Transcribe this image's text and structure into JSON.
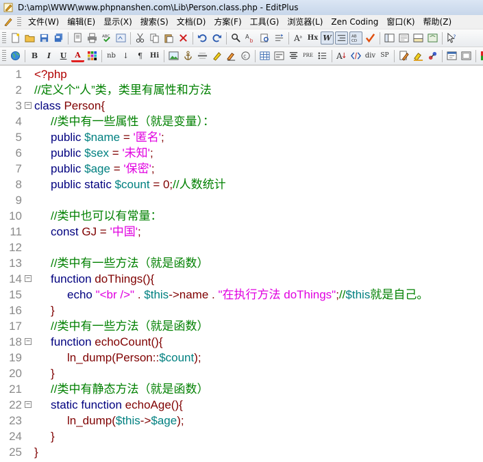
{
  "window": {
    "title": "D:\\amp\\WWW\\www.phpnanshen.com\\Lib\\Person.class.php - EditPlus"
  },
  "menu": [
    "文件(W)",
    "编辑(E)",
    "显示(X)",
    "搜索(S)",
    "文档(D)",
    "方案(F)",
    "工具(G)",
    "浏览器(L)",
    "Zen Coding",
    "窗口(K)",
    "帮助(Z)"
  ],
  "toolbar2_labels": {
    "bold": "B",
    "italic": "I",
    "underline": "U",
    "font_color": "A",
    "nbsp": "nb",
    "link": "↓",
    "paragraph": "¶",
    "heading": "Hi",
    "font_size": "A",
    "hx": "Hx",
    "word_wrap": "W",
    "preview": "PRE",
    "div": "div",
    "span": "SP"
  },
  "editor": {
    "lines": [
      {
        "n": "1",
        "fold": false,
        "indent": 0,
        "tokens": [
          {
            "t": "<?php",
            "c": "p"
          }
        ]
      },
      {
        "n": "2",
        "fold": false,
        "indent": 0,
        "tokens": [
          {
            "t": "//定义个“人”类，类里有属性和方法",
            "c": "c"
          }
        ]
      },
      {
        "n": "3",
        "fold": true,
        "indent": 0,
        "tokens": [
          {
            "t": "class ",
            "c": "k"
          },
          {
            "t": "Person{",
            "c": "d"
          }
        ]
      },
      {
        "n": "4",
        "fold": false,
        "indent": 1,
        "tokens": [
          {
            "t": "//类中有一些属性（就是变量）：",
            "c": "c"
          }
        ]
      },
      {
        "n": "5",
        "fold": false,
        "indent": 1,
        "tokens": [
          {
            "t": "public ",
            "c": "k"
          },
          {
            "t": "$name",
            "c": "v"
          },
          {
            "t": " = ",
            "c": "d"
          },
          {
            "t": "'匿名'",
            "c": "s"
          },
          {
            "t": ";",
            "c": "d"
          }
        ]
      },
      {
        "n": "6",
        "fold": false,
        "indent": 1,
        "tokens": [
          {
            "t": "public ",
            "c": "k"
          },
          {
            "t": "$sex",
            "c": "v"
          },
          {
            "t": " = ",
            "c": "d"
          },
          {
            "t": "'未知'",
            "c": "s"
          },
          {
            "t": ";",
            "c": "d"
          }
        ]
      },
      {
        "n": "7",
        "fold": false,
        "indent": 1,
        "tokens": [
          {
            "t": "public ",
            "c": "k"
          },
          {
            "t": "$age",
            "c": "v"
          },
          {
            "t": " = ",
            "c": "d"
          },
          {
            "t": "'保密'",
            "c": "s"
          },
          {
            "t": ";",
            "c": "d"
          }
        ]
      },
      {
        "n": "8",
        "fold": false,
        "indent": 1,
        "tokens": [
          {
            "t": "public static ",
            "c": "k"
          },
          {
            "t": "$count",
            "c": "v"
          },
          {
            "t": " = 0;",
            "c": "d"
          },
          {
            "t": "//人数统计",
            "c": "c"
          }
        ]
      },
      {
        "n": "9",
        "fold": false,
        "indent": 0,
        "tokens": []
      },
      {
        "n": "10",
        "fold": false,
        "indent": 1,
        "tokens": [
          {
            "t": "//类中也可以有常量：",
            "c": "c"
          }
        ]
      },
      {
        "n": "11",
        "fold": false,
        "indent": 1,
        "tokens": [
          {
            "t": "const ",
            "c": "k"
          },
          {
            "t": "GJ = ",
            "c": "d"
          },
          {
            "t": "'中国'",
            "c": "s"
          },
          {
            "t": ";",
            "c": "d"
          }
        ]
      },
      {
        "n": "12",
        "fold": false,
        "indent": 0,
        "tokens": []
      },
      {
        "n": "13",
        "fold": false,
        "indent": 1,
        "tokens": [
          {
            "t": "//类中有一些方法（就是函数）",
            "c": "c"
          }
        ]
      },
      {
        "n": "14",
        "fold": true,
        "indent": 1,
        "tokens": [
          {
            "t": "function ",
            "c": "k"
          },
          {
            "t": "doThings(){",
            "c": "d"
          }
        ]
      },
      {
        "n": "15",
        "fold": false,
        "indent": 2,
        "tokens": [
          {
            "t": "echo ",
            "c": "k"
          },
          {
            "t": "\"<br />\"",
            "c": "s"
          },
          {
            "t": " . ",
            "c": "d"
          },
          {
            "t": "$this",
            "c": "v"
          },
          {
            "t": "->name . ",
            "c": "d"
          },
          {
            "t": "\"在执行方法 doThings\"",
            "c": "s"
          },
          {
            "t": ";",
            "c": "d"
          },
          {
            "t": "//",
            "c": "c"
          },
          {
            "t": "$this",
            "c": "v"
          },
          {
            "t": "就是自己。",
            "c": "c"
          }
        ]
      },
      {
        "n": "16",
        "fold": false,
        "indent": 1,
        "tokens": [
          {
            "t": "}",
            "c": "d"
          }
        ]
      },
      {
        "n": "17",
        "fold": false,
        "indent": 1,
        "tokens": [
          {
            "t": "//类中有一些方法（就是函数）",
            "c": "c"
          }
        ]
      },
      {
        "n": "18",
        "fold": true,
        "indent": 1,
        "tokens": [
          {
            "t": "function ",
            "c": "k"
          },
          {
            "t": "echoCount(){",
            "c": "d"
          }
        ]
      },
      {
        "n": "19",
        "fold": false,
        "indent": 2,
        "tokens": [
          {
            "t": "ln_dump(Person::",
            "c": "d"
          },
          {
            "t": "$count",
            "c": "v"
          },
          {
            "t": ");",
            "c": "d"
          }
        ]
      },
      {
        "n": "20",
        "fold": false,
        "indent": 1,
        "tokens": [
          {
            "t": "}",
            "c": "d"
          }
        ]
      },
      {
        "n": "21",
        "fold": false,
        "indent": 1,
        "tokens": [
          {
            "t": "//类中有静态方法（就是函数）",
            "c": "c"
          }
        ]
      },
      {
        "n": "22",
        "fold": true,
        "indent": 1,
        "tokens": [
          {
            "t": "static function ",
            "c": "k"
          },
          {
            "t": "echoAge(){",
            "c": "d"
          }
        ]
      },
      {
        "n": "23",
        "fold": false,
        "indent": 2,
        "tokens": [
          {
            "t": "ln_dump(",
            "c": "d"
          },
          {
            "t": "$this",
            "c": "v"
          },
          {
            "t": "->",
            "c": "d"
          },
          {
            "t": "$age",
            "c": "v"
          },
          {
            "t": ");",
            "c": "d"
          }
        ]
      },
      {
        "n": "24",
        "fold": false,
        "indent": 1,
        "tokens": [
          {
            "t": "}",
            "c": "d"
          }
        ]
      },
      {
        "n": "25",
        "fold": false,
        "indent": 0,
        "tokens": [
          {
            "t": "}",
            "c": "d"
          }
        ]
      }
    ]
  }
}
